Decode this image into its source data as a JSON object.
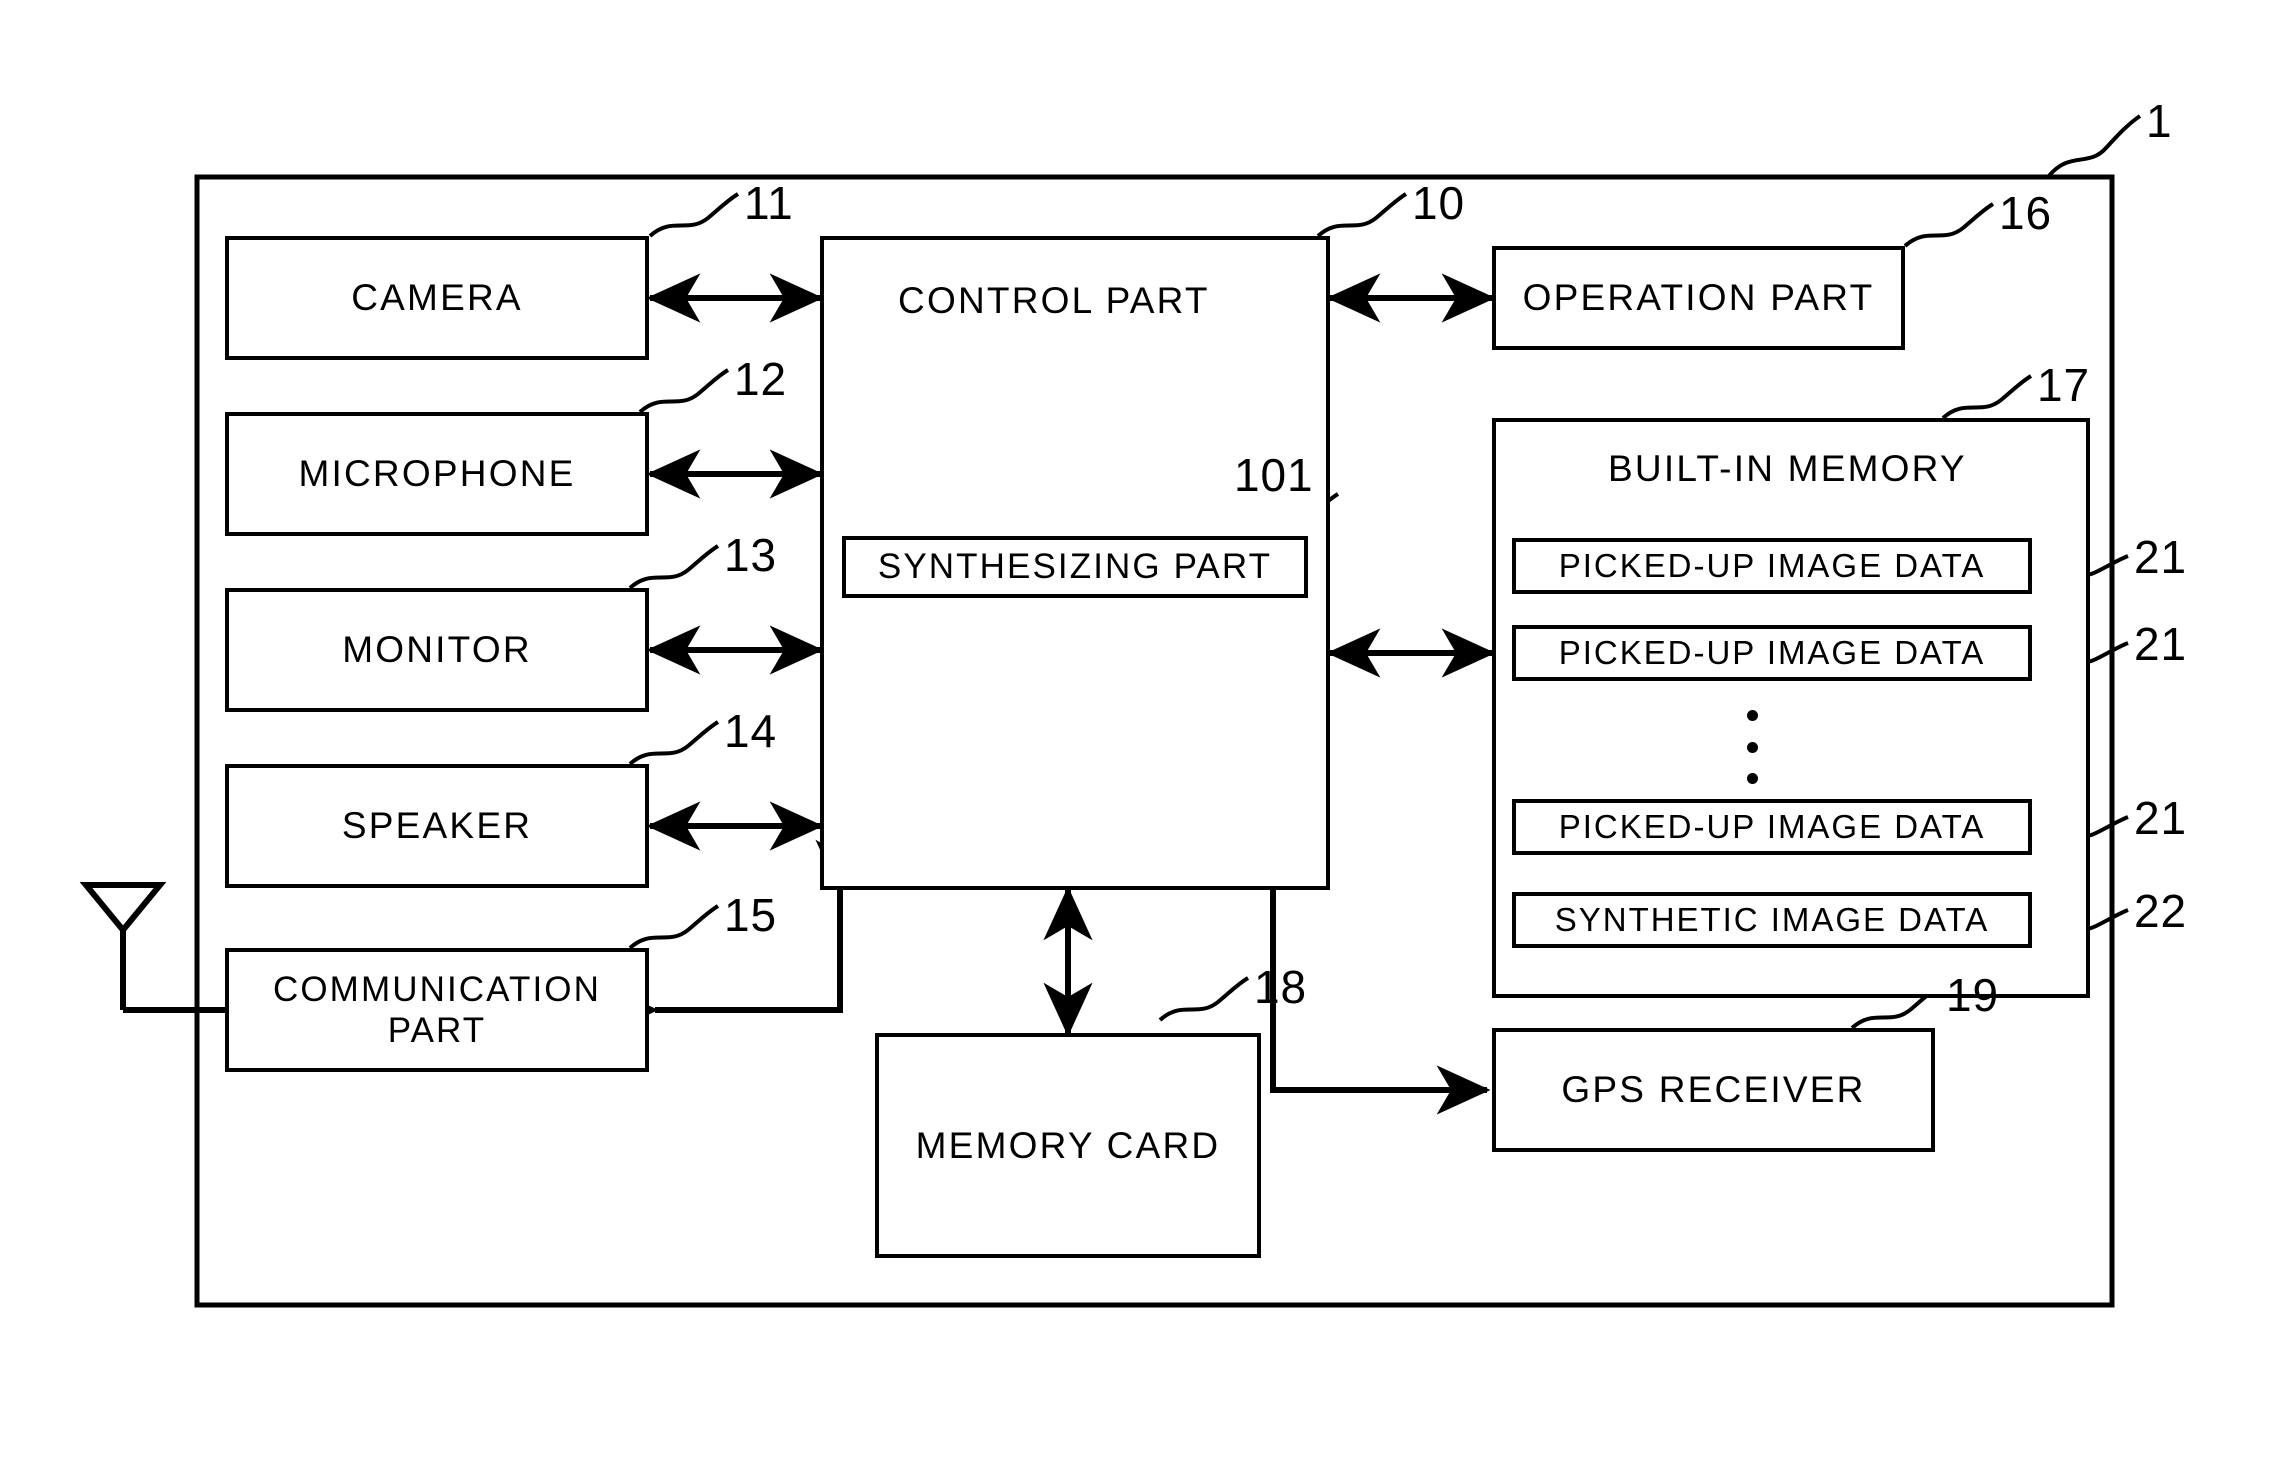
{
  "figure": {
    "type": "block-diagram",
    "device_ref": "1",
    "outer_frame_label": "1"
  },
  "blocks": {
    "camera": {
      "label": "CAMERA",
      "ref": "11"
    },
    "microphone": {
      "label": "MICROPHONE",
      "ref": "12"
    },
    "monitor": {
      "label": "MONITOR",
      "ref": "13"
    },
    "speaker": {
      "label": "SPEAKER",
      "ref": "14"
    },
    "communication": {
      "label": "COMMUNICATION PART",
      "label_line1": "COMMUNICATION",
      "label_line2": "PART",
      "ref": "15"
    },
    "control": {
      "label": "CONTROL PART",
      "ref": "10"
    },
    "synthesizing": {
      "label": "SYNTHESIZING PART",
      "ref": "101"
    },
    "operation": {
      "label": "OPERATION PART",
      "ref": "16"
    },
    "memory": {
      "label": "BUILT-IN MEMORY",
      "ref": "17"
    },
    "memory_card": {
      "label": "MEMORY CARD",
      "ref": "18"
    },
    "gps": {
      "label": "GPS RECEIVER",
      "ref": "19"
    }
  },
  "memory_items": [
    {
      "label": "PICKED-UP IMAGE DATA",
      "ref": "21"
    },
    {
      "label": "PICKED-UP IMAGE DATA",
      "ref": "21"
    },
    {
      "label": "PICKED-UP IMAGE DATA",
      "ref": "21"
    },
    {
      "label": "SYNTHETIC IMAGE DATA",
      "ref": "22"
    }
  ],
  "ellipsis": "⋮",
  "icons": {
    "antenna": "antenna-icon"
  },
  "colors": {
    "line": "#000000",
    "background": "#ffffff"
  }
}
